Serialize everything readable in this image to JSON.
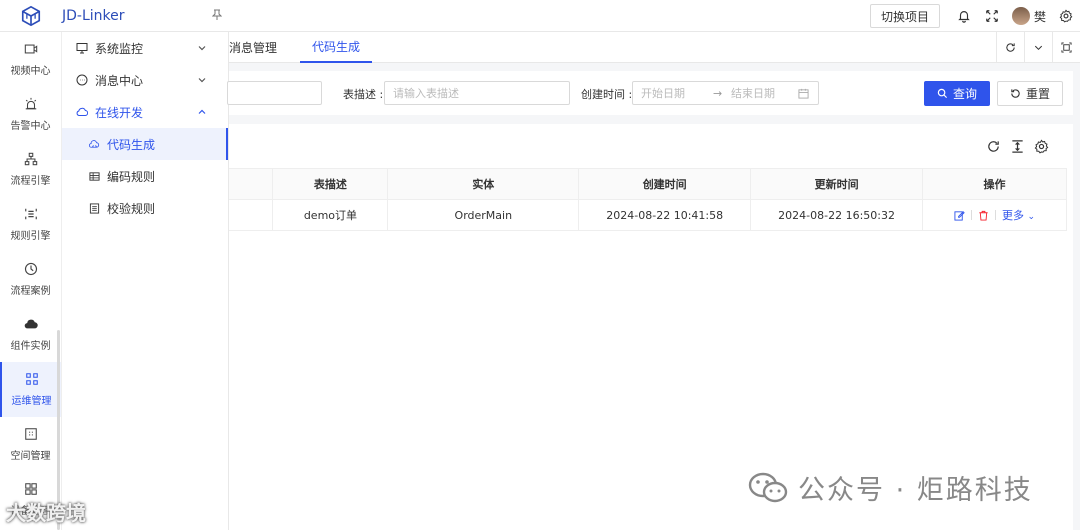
{
  "header": {
    "app_title": "JD-Linker",
    "switch_project": "切换项目",
    "user_name": "樊"
  },
  "rail": {
    "items": [
      {
        "label": "视频中心",
        "icon": "video-icon"
      },
      {
        "label": "告警中心",
        "icon": "alarm-icon"
      },
      {
        "label": "流程引擎",
        "icon": "flow-icon"
      },
      {
        "label": "规则引擎",
        "icon": "rule-icon"
      },
      {
        "label": "流程案例",
        "icon": "clock-icon"
      },
      {
        "label": "组件实例",
        "icon": "cloud-icon"
      },
      {
        "label": "运维管理",
        "icon": "ops-icon"
      },
      {
        "label": "空间管理",
        "icon": "space-icon"
      },
      {
        "label": "设备管理",
        "icon": "device-icon"
      }
    ]
  },
  "submenu": {
    "monitor": "系统监控",
    "message": "消息中心",
    "online_dev": "在线开发",
    "code_gen": "代码生成",
    "code_rules": "编码规则",
    "check_rules": "校验规则"
  },
  "tabs": {
    "message_mgmt": "消息管理",
    "code_gen": "代码生成"
  },
  "filter": {
    "desc_label": "表描述 :",
    "desc_placeholder": "请输入表描述",
    "time_label": "创建时间 :",
    "start_placeholder": "开始日期",
    "arrow": "→",
    "end_placeholder": "结束日期",
    "search": "查询",
    "reset": "重置"
  },
  "table": {
    "headers": [
      "表描述",
      "实体",
      "创建时间",
      "更新时间",
      "操作"
    ],
    "rows": [
      {
        "desc": "demo订单",
        "entity": "OrderMain",
        "created": "2024-08-22 10:41:58",
        "updated": "2024-08-22 16:50:32",
        "more": "更多"
      }
    ]
  },
  "watermark": {
    "right": "公众号 · 炬路科技",
    "left": "大数跨境"
  },
  "colors": {
    "accent": "#2f54eb",
    "brand_title": "#2c4db8",
    "delete": "#f5222d"
  }
}
